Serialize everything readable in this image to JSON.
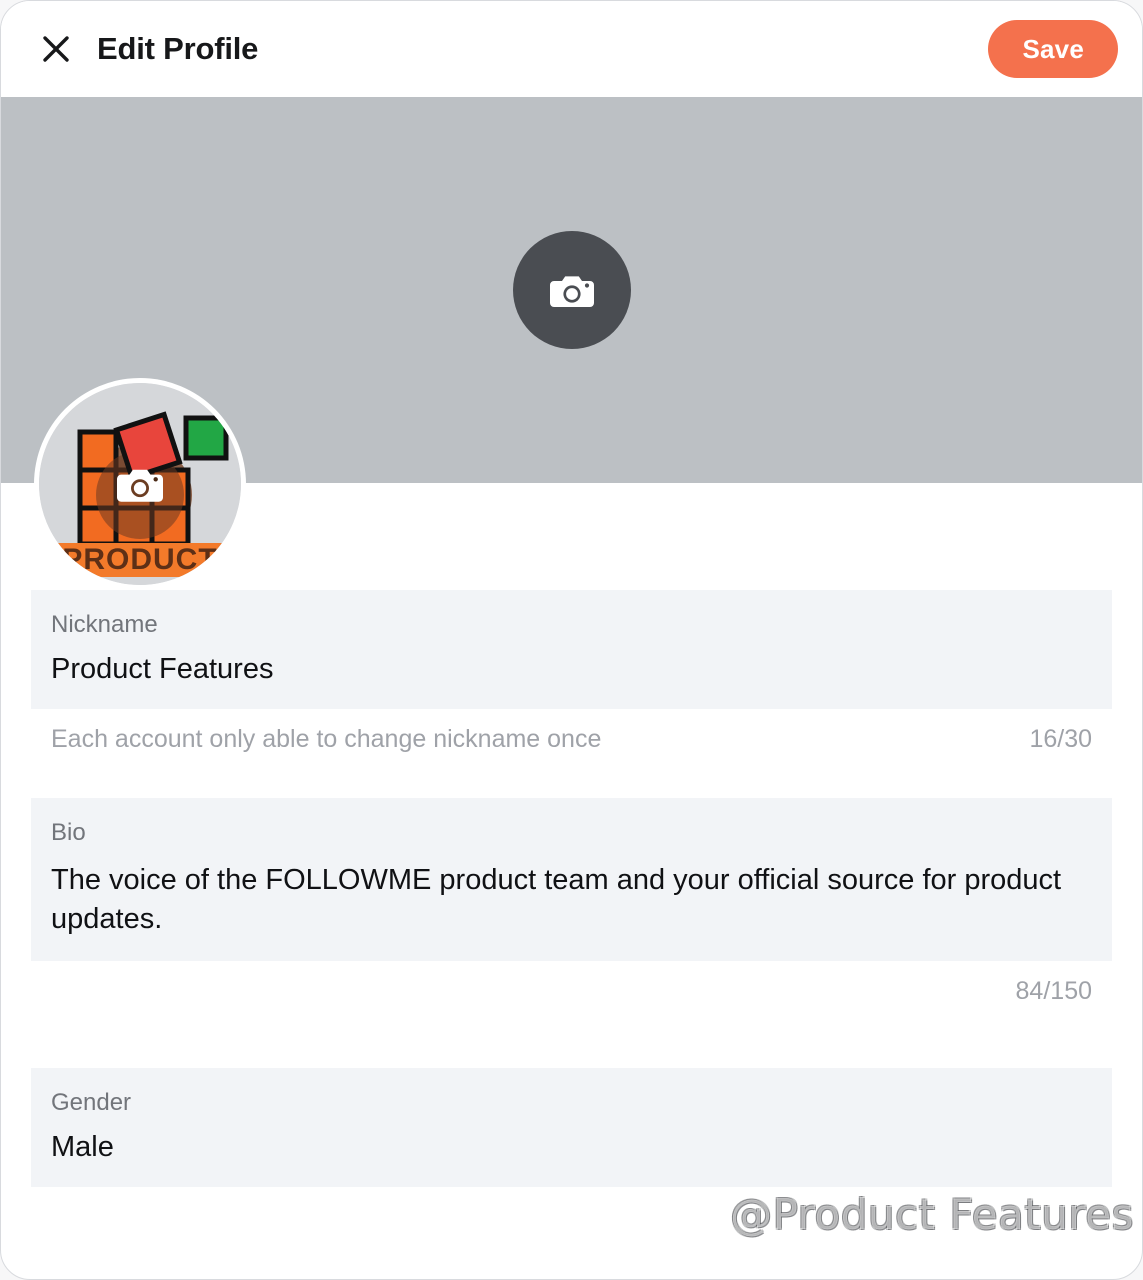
{
  "header": {
    "close_icon": "close-icon",
    "title": "Edit Profile",
    "save_label": "Save"
  },
  "cover": {
    "camera_icon": "camera-icon",
    "background_color": "#bcc0c4",
    "button_color": "#4a4d52"
  },
  "avatar": {
    "camera_icon": "camera-icon",
    "logo_text": "PRODUCT",
    "colors": {
      "tile_orange": "#f26b21",
      "tile_red": "#e8453c",
      "tile_green": "#22a745",
      "band_orange": "#f37a2a",
      "ring": "#ffffff",
      "background": "#d5d7da"
    }
  },
  "fields": {
    "nickname": {
      "label": "Nickname",
      "value": "Product Features",
      "hint": "Each account only able to change nickname once",
      "counter": "16/30"
    },
    "bio": {
      "label": "Bio",
      "value": "The voice of the FOLLOWME product team and your official source for product updates.",
      "counter": "84/150"
    },
    "gender": {
      "label": "Gender",
      "value": "Male"
    }
  },
  "watermark": {
    "logo_icon": "followme-f-icon",
    "text": "@Product Features"
  },
  "theme": {
    "accent": "#f4714d",
    "field_bg": "#f2f4f7",
    "label_gray": "#72757b",
    "muted_gray": "#9fa2a8",
    "text_dark": "#101114"
  }
}
